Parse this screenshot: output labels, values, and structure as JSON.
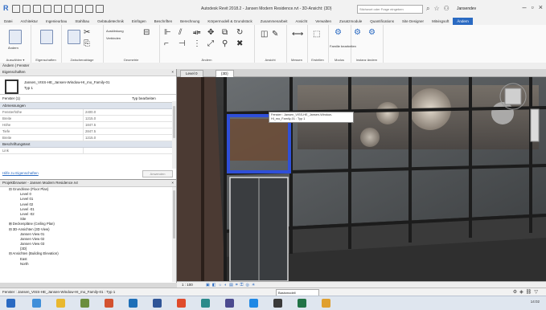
{
  "app": {
    "title": "Autodesk Revit 2018.2 - Jansen Modern Residence.rvt - 3D-Ansicht: {3D}",
    "search_placeholder": "Stichwort oder Frage eingeben",
    "user": "Jansendev",
    "accent": "#2a6ac2"
  },
  "ribbon_tabs": [
    "Datei",
    "Architektur",
    "Ingenieurbau",
    "Stahlbau",
    "Gebäudetechnik",
    "Einfügen",
    "Beschriften",
    "Berechnung",
    "Körpermodell & Grundstück",
    "Zusammenarbeit",
    "Ansicht",
    "Verwalten",
    "Zusatzmodule",
    "Quantifications",
    "Site Designer",
    "Mitvisgsoft",
    "Ändern"
  ],
  "ribbon_panels": [
    {
      "label": "Auswählen ▾"
    },
    {
      "label": "Eigenschaften"
    },
    {
      "label": "Zwischenablage"
    },
    {
      "label": "Geometrie"
    },
    {
      "label": "Ändern"
    },
    {
      "label": "Ansicht"
    },
    {
      "label": "Messen"
    },
    {
      "label": "Erstellen"
    },
    {
      "label": "Modus"
    },
    {
      "label": "Instanz ändern"
    }
  ],
  "ribbon_buttons": {
    "modify": "Ändern",
    "cut": "Ausklinkung",
    "join": "Verbinden",
    "family": "Familie bearbeiten",
    "host": "Hauptbauteil",
    "pick": "Neu wählen"
  },
  "context_bar": "Ändern | Fenster",
  "properties": {
    "title": "Eigenschaften",
    "type_name": "Jansen_VISS-HE_Jansen-Window-HI_mo_Family-01",
    "type_sub": "Typ 1",
    "filter": "Fenster (1)",
    "edit_type": "Typ bearbeiten",
    "groups": [
      {
        "name": "Abmessungen",
        "rows": [
          {
            "k": "Fensterhöhe",
            "v": "2400.0"
          },
          {
            "k": "Breite",
            "v": "1215.0"
          },
          {
            "k": "Höhe",
            "v": "1847.5"
          },
          {
            "k": "Tiefe",
            "v": "2847.5"
          },
          {
            "k": "Breite",
            "v": "1215.0"
          }
        ]
      },
      {
        "name": "Beschriftungstext",
        "rows": [
          {
            "k": "Link",
            "v": ""
          }
        ]
      }
    ],
    "help_link": "Hilfe zu Eigenschaften",
    "apply": "Anwenden"
  },
  "browser": {
    "title": "Projektbrowser - Jansen Modern Residence.rvt",
    "items": [
      {
        "t": "⊟ Grundrisse (Floor Plan)",
        "d": 1
      },
      {
        "t": "Level 0",
        "d": 3
      },
      {
        "t": "Level 01",
        "d": 3
      },
      {
        "t": "Level 02",
        "d": 3
      },
      {
        "t": "Level -01",
        "d": 3
      },
      {
        "t": "Level -02",
        "d": 3
      },
      {
        "t": "Site",
        "d": 3
      },
      {
        "t": "⊞ Deckenpläne (Ceiling Plan)",
        "d": 1
      },
      {
        "t": "⊟ 3D-Ansichten (3D View)",
        "d": 1
      },
      {
        "t": "Jansen View 01",
        "d": 3
      },
      {
        "t": "Jansen View 02",
        "d": 3
      },
      {
        "t": "Jansen View 03",
        "d": 3
      },
      {
        "t": "{3D}",
        "d": 3
      },
      {
        "t": "⊟ Ansichten (Building Elevation)",
        "d": 1
      },
      {
        "t": "East",
        "d": 3
      },
      {
        "t": "North",
        "d": 3
      }
    ]
  },
  "view_tabs": [
    "Level 0",
    "{3D}"
  ],
  "tooltip": "Fenster : Jansen_VISS-HE_Jansen-Window-HI_mo_Family-01 : Typ 1",
  "view_bar": {
    "scale": "1 : 100"
  },
  "status": {
    "text": "Fenster : Jansen_VISS-HE_Jansen-Window-HI_mo_Family-01 : Typ 1",
    "model": "Basismodell"
  },
  "taskbar": {
    "clock": "14:02"
  }
}
